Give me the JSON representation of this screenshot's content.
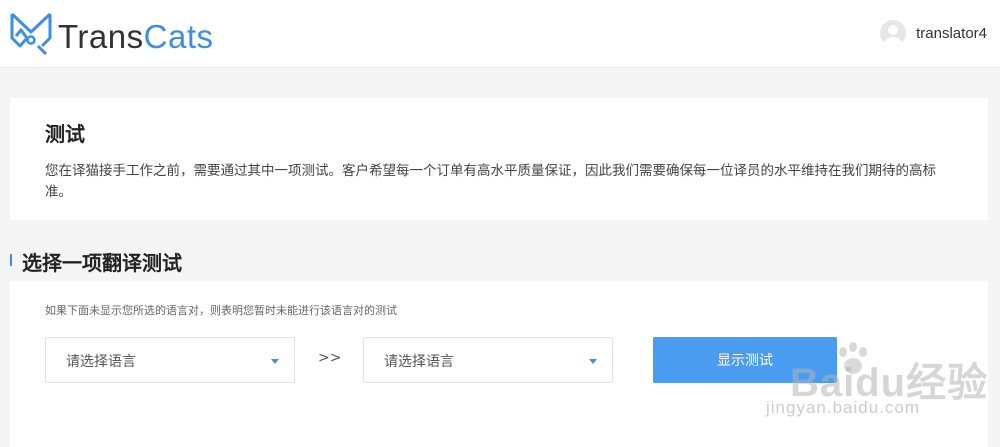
{
  "header": {
    "logo_text_part1": "Trans",
    "logo_text_part2": "Cats",
    "logo_icon": "cat-ears-logo-icon",
    "username": "translator4",
    "avatar_icon": "default-avatar-icon"
  },
  "intro": {
    "title": "测试",
    "description": "您在译猫接手工作之前，需要通过其中一项测试。客户希望每一个订单有高水平质量保证，因此我们需要确保每一位译员的水平维持在我们期待的高标准。"
  },
  "section": {
    "title": "选择一项翻译测试"
  },
  "selector": {
    "note": "如果下面未显示您所选的语言对，则表明您暂时未能进行该语言对的测试",
    "source_language": "请选择语言",
    "target_language": "请选择语言",
    "separator": ">>",
    "show_button": "显示测试",
    "caret_icon": "caret-down-icon"
  },
  "watermark": {
    "main": "Baidu经验",
    "sub": "jingyan.baidu.com"
  },
  "colors": {
    "accent": "#3e8ee8",
    "button": "#4a9cf0",
    "background": "#f5f5f5"
  }
}
